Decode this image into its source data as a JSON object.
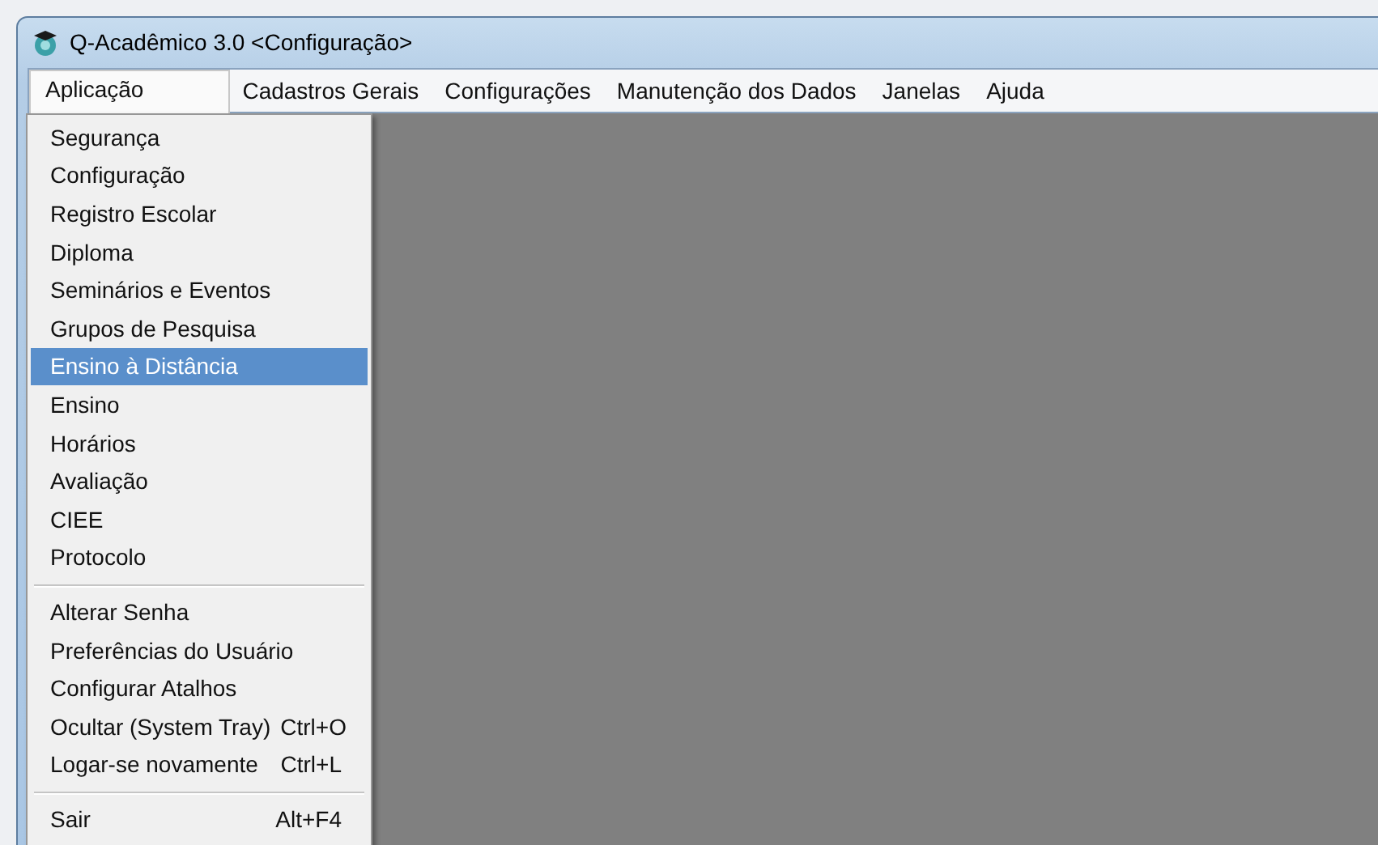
{
  "window": {
    "title": "Q-Acadêmico 3.0 <Configuração>"
  },
  "menubar": [
    {
      "label": "Aplicação",
      "selected": true
    },
    {
      "label": "Cadastros Gerais",
      "selected": false
    },
    {
      "label": "Configurações",
      "selected": false
    },
    {
      "label": "Manutenção dos Dados",
      "selected": false
    },
    {
      "label": "Janelas",
      "selected": false
    },
    {
      "label": "Ajuda",
      "selected": false
    }
  ],
  "menu": {
    "items": [
      {
        "kind": "item",
        "label": "Segurança",
        "selected": false
      },
      {
        "kind": "item",
        "label": "Configuração",
        "selected": false
      },
      {
        "kind": "item",
        "label": "Registro Escolar",
        "selected": false
      },
      {
        "kind": "item",
        "label": "Diploma",
        "selected": false
      },
      {
        "kind": "item",
        "label": "Seminários e Eventos",
        "selected": false
      },
      {
        "kind": "item",
        "label": "Grupos de Pesquisa",
        "selected": false
      },
      {
        "kind": "item",
        "label": "Ensino à Distância",
        "selected": true
      },
      {
        "kind": "item",
        "label": "Ensino",
        "selected": false
      },
      {
        "kind": "item",
        "label": "Horários",
        "selected": false
      },
      {
        "kind": "item",
        "label": "Avaliação",
        "selected": false
      },
      {
        "kind": "item",
        "label": "CIEE",
        "selected": false
      },
      {
        "kind": "item",
        "label": "Protocolo",
        "selected": false
      },
      {
        "kind": "separator"
      },
      {
        "kind": "item",
        "label": "Alterar Senha",
        "selected": false
      },
      {
        "kind": "item",
        "label": "Preferências do Usuário",
        "selected": false
      },
      {
        "kind": "item",
        "label": "Configurar Atalhos",
        "selected": false
      },
      {
        "kind": "item",
        "label": "Ocultar (System Tray)",
        "shortcut": "Ctrl+O",
        "selected": false
      },
      {
        "kind": "item",
        "label": "Logar-se novamente",
        "shortcut": "Ctrl+L",
        "selected": false
      },
      {
        "kind": "separator"
      },
      {
        "kind": "item",
        "label": "Sair",
        "shortcut": "Alt+F4",
        "selected": false
      }
    ]
  }
}
